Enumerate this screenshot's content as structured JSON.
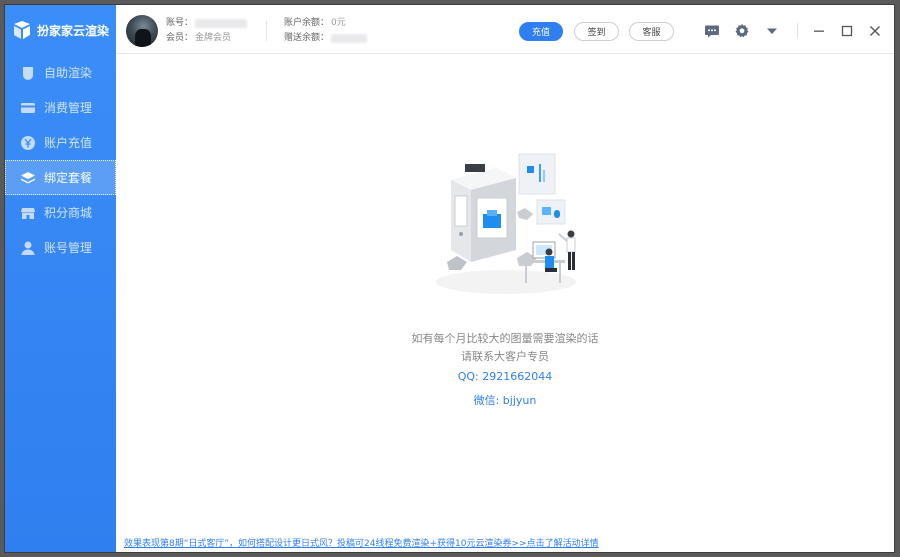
{
  "app": {
    "name": "扮家家云渲染"
  },
  "sidebar": {
    "items": [
      {
        "label": "自助渲染",
        "icon": "drop-icon",
        "active": false
      },
      {
        "label": "消费管理",
        "icon": "card-icon",
        "active": false
      },
      {
        "label": "账户充值",
        "icon": "yen-icon",
        "active": false
      },
      {
        "label": "绑定套餐",
        "icon": "layers-icon",
        "active": true
      },
      {
        "label": "积分商城",
        "icon": "store-icon",
        "active": false
      },
      {
        "label": "账号管理",
        "icon": "user-icon",
        "active": false
      }
    ]
  },
  "header": {
    "account_label": "账号：",
    "member_label": "会员：",
    "member_value": "金牌会员",
    "balance_label": "账户余额：",
    "balance_value": "0元",
    "gift_label": "赠送余额：",
    "recharge_button": "充值",
    "checkin_button": "签到",
    "service_button": "客服"
  },
  "main": {
    "message_line1": "如有每个月比较大的图量需要渲染的话",
    "message_line2": "请联系大客户专员",
    "qq": "QQ:  2921662044",
    "wechat": "微信:  bjjyun",
    "footer_link": "效果表现第8期“日式客厅”，如何搭配设计更日式风？投稿可24线程免费渲染+获得10元云渲染券>>点击了解活动详情"
  },
  "colors": {
    "accent": "#2f7ff0",
    "sidebar_active": "#5a9ef6"
  }
}
